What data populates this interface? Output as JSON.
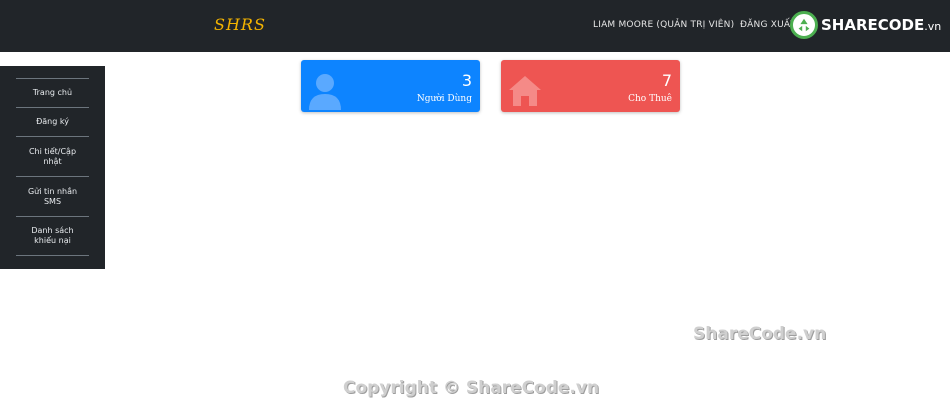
{
  "navbar": {
    "brand": "SHRS",
    "user_label": "LIAM MOORE (QUẢN TRỊ VIÊN)",
    "logout_label": "ĐĂNG XUẤT",
    "bg_color": "#212529",
    "brand_color": "#f4b400"
  },
  "watermark_logo": {
    "text": "SHARECODE",
    "suffix": ".vn"
  },
  "sidebar": {
    "items": [
      {
        "label": "Trang chủ"
      },
      {
        "label": "Đăng ký"
      },
      {
        "label": "Chi tiết/Cập nhật"
      },
      {
        "label": "Gửi tin nhắn SMS"
      },
      {
        "label": "Danh sách khiếu nại"
      }
    ]
  },
  "cards": [
    {
      "value": "3",
      "label": "Người Dùng",
      "icon": "user-icon",
      "color": "#0d84ff"
    },
    {
      "value": "7",
      "label": "Cho Thuê",
      "icon": "home-icon",
      "color": "#ee5552"
    }
  ],
  "watermarks": {
    "middle": "ShareCode.vn",
    "bottom": "Copyright © ShareCode.vn"
  }
}
